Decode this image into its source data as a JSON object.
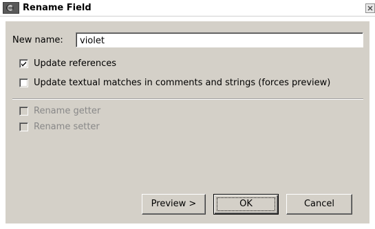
{
  "window": {
    "title": "Rename Field",
    "icon": "eclipse-icon",
    "close_icon": "close-icon"
  },
  "form": {
    "new_name_label": "New name:",
    "new_name_value": "violet",
    "options": [
      {
        "label": "Update references",
        "checked": true,
        "enabled": true
      },
      {
        "label": "Update textual matches in comments and strings (forces preview)",
        "checked": false,
        "enabled": true
      },
      {
        "label": "Rename getter",
        "checked": false,
        "enabled": false
      },
      {
        "label": "Rename setter",
        "checked": false,
        "enabled": false
      }
    ]
  },
  "buttons": {
    "preview_label": "Preview >",
    "ok_label": "OK",
    "cancel_label": "Cancel"
  },
  "colors": {
    "dialog_face": "#d4d0c8",
    "disabled_text": "#888888"
  }
}
